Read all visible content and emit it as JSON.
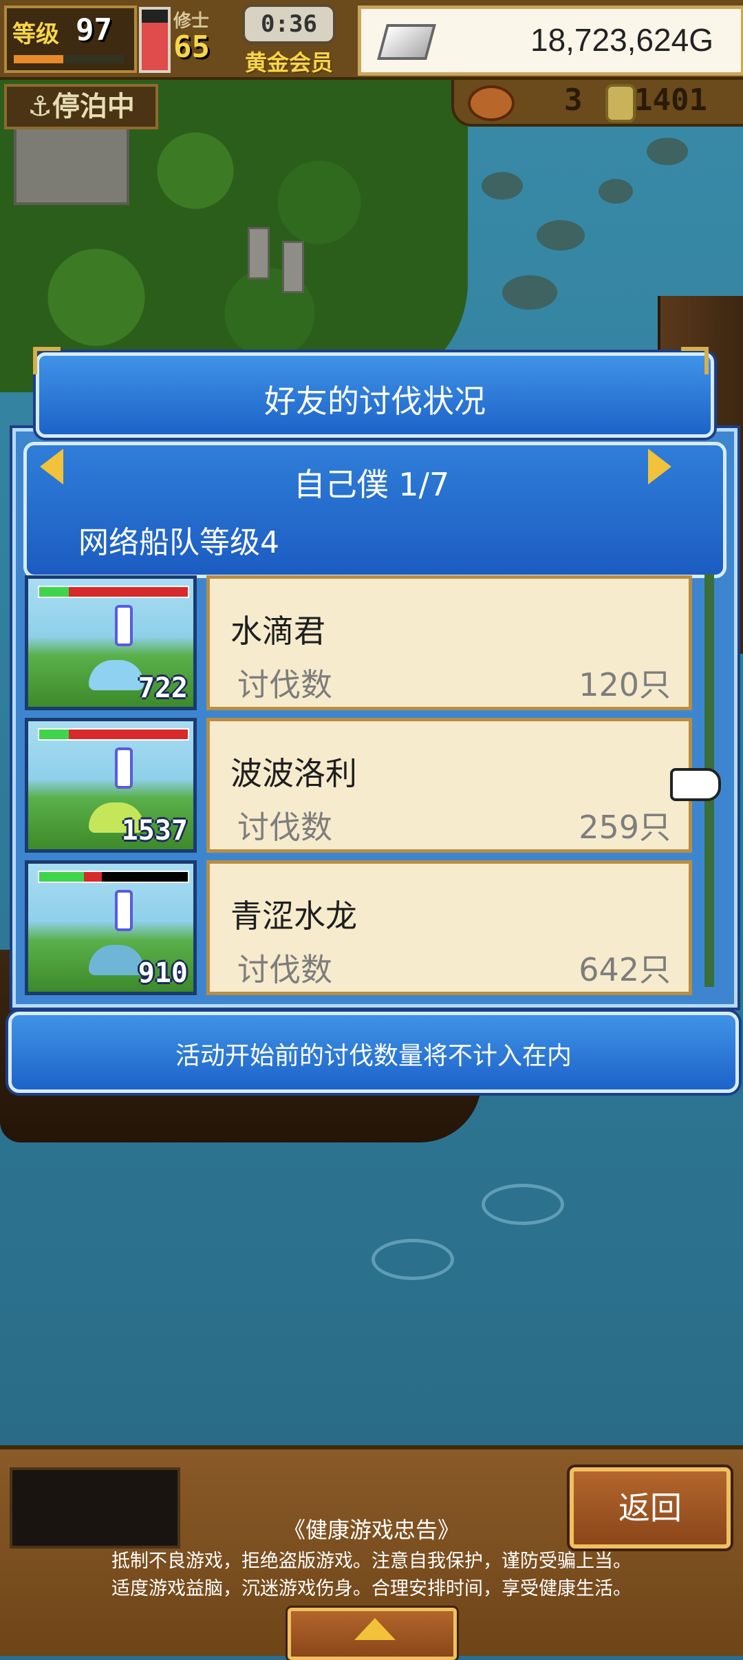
{
  "hud": {
    "level_label": "等级",
    "level": "97",
    "level_progress": 0.45,
    "stamina_level": 0.78,
    "vip_label": "修士",
    "vip_level": "65",
    "timer": "0:36",
    "member_label": "黄金会员",
    "gold_icon": "silver-bar-icon",
    "gold": "18,723,624G",
    "status": "⚓停泊中",
    "food_icon": "meat-icon",
    "ship_count": "3",
    "coin_icon": "medal-icon",
    "coins": "1401"
  },
  "dialog": {
    "title": "好友的讨伐状况",
    "page_label": "自己僕 1/7",
    "fleet_level": "网络船队等级4",
    "prev_icon": "arrow-left-icon",
    "next_icon": "arrow-right-icon",
    "rows": [
      {
        "name": "水滴君",
        "kills_label": "讨伐数",
        "kills": "120只",
        "hp": "722",
        "hp_green": 0.2,
        "hp_red": 0.8,
        "monster_color": "#8fd1f0"
      },
      {
        "name": "波波洛利",
        "kills_label": "讨伐数",
        "kills": "259只",
        "hp": "1537",
        "hp_green": 0.2,
        "hp_red": 0.8,
        "monster_color": "#c6e65a"
      },
      {
        "name": "青涩水龙",
        "kills_label": "讨伐数",
        "kills": "642只",
        "hp": "910",
        "hp_green": 0.3,
        "hp_red": 0.12,
        "monster_color": "#6fb6d6"
      }
    ],
    "notice": "活动开始前的讨伐数量将不计入在内"
  },
  "bottom": {
    "back_label": "返回",
    "health_title": "《健康游戏忠告》",
    "health_line1": "抵制不良游戏，拒绝盗版游戏。注意自我保护，谨防受骗上当。",
    "health_line2": "适度游戏益脑，沉迷游戏伤身。合理安排时间，享受健康生活。",
    "up_icon": "up-arrow-icon"
  },
  "colors": {
    "dialog_blue": "#1d63c9",
    "card_bg": "#f6ebcd",
    "gold_accent": "#f2c23a",
    "hp_green": "#3fd54a",
    "hp_red": "#d82a2a"
  }
}
